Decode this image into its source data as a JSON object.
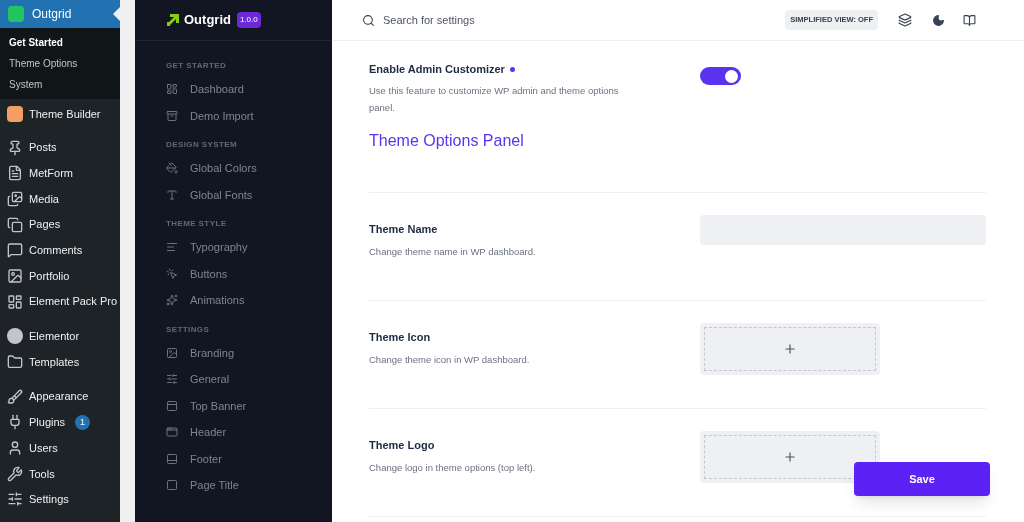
{
  "wp_menu": {
    "current": {
      "label": "Outgrid",
      "selected": true
    },
    "submenu": [
      {
        "label": "Get Started",
        "selected": true
      },
      {
        "label": "Theme Options",
        "selected": false
      },
      {
        "label": "System",
        "selected": false
      }
    ],
    "groups": [
      [
        {
          "label": "Theme Builder"
        }
      ],
      [
        {
          "label": "Posts"
        },
        {
          "label": "MetForm"
        },
        {
          "label": "Media"
        },
        {
          "label": "Pages"
        },
        {
          "label": "Comments"
        },
        {
          "label": "Portfolio"
        },
        {
          "label": "Element Pack Pro"
        }
      ],
      [
        {
          "label": "Elementor"
        },
        {
          "label": "Templates"
        }
      ],
      [
        {
          "label": "Appearance"
        },
        {
          "label": "Plugins",
          "badge": "1"
        },
        {
          "label": "Users"
        },
        {
          "label": "Tools"
        },
        {
          "label": "Settings"
        }
      ]
    ]
  },
  "brand": {
    "name": "Outgrid",
    "version": "1.0.0"
  },
  "nav": [
    {
      "title": "GET STARTED",
      "items": [
        "Dashboard",
        "Demo Import"
      ]
    },
    {
      "title": "DESIGN SYSTEM",
      "items": [
        "Global Colors",
        "Global Fonts"
      ]
    },
    {
      "title": "THEME STYLE",
      "items": [
        "Typography",
        "Buttons",
        "Animations"
      ]
    },
    {
      "title": "SETTINGS",
      "items": [
        "Branding",
        "General",
        "Top Banner",
        "Header",
        "Footer",
        "Page Title"
      ]
    }
  ],
  "search": {
    "placeholder": "Search for settings"
  },
  "simplified_view": "SIMPLIFIED VIEW: OFF",
  "customizer": {
    "label": "Enable Admin Customizer",
    "description": "Use this feature to customize WP admin and theme options panel.",
    "on": true
  },
  "section_title": "Theme Options Panel",
  "fields": [
    {
      "kind": "text",
      "label": "Theme Name",
      "description": "Change theme name in WP dashboard."
    },
    {
      "kind": "upload",
      "label": "Theme Icon",
      "description": "Change theme icon in WP dashboard."
    },
    {
      "kind": "upload",
      "label": "Theme Logo",
      "description": "Change logo in theme options (top left)."
    }
  ],
  "save": "Save"
}
